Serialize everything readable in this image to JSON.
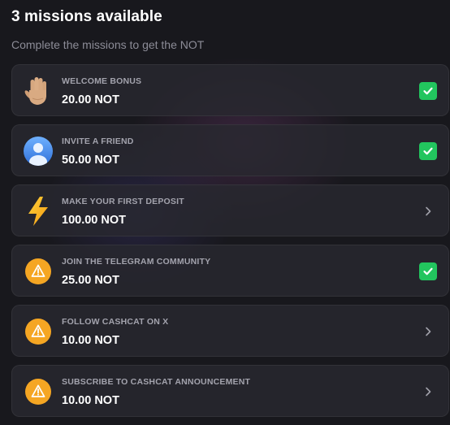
{
  "header": {
    "title": "3 missions available",
    "subtitle": "Complete the missions to get the NOT"
  },
  "missions": [
    {
      "name": "WELCOME BONUS",
      "reward": "20.00 NOT",
      "icon": "raised-hand-icon",
      "status": "completed"
    },
    {
      "name": "INVITE A FRIEND",
      "reward": "50.00 NOT",
      "icon": "user-avatar-icon",
      "status": "completed"
    },
    {
      "name": "MAKE YOUR FIRST DEPOSIT",
      "reward": "100.00 NOT",
      "icon": "lightning-bolt-icon",
      "status": "open"
    },
    {
      "name": "JOIN THE TELEGRAM COMMUNITY",
      "reward": "25.00 NOT",
      "icon": "warning-icon",
      "status": "completed"
    },
    {
      "name": "FOLLOW CASHCAT ON X",
      "reward": "10.00 NOT",
      "icon": "warning-icon",
      "status": "open"
    },
    {
      "name": "SUBSCRIBE TO CASHCAT ANNOUNCEMENT",
      "reward": "10.00 NOT",
      "icon": "warning-icon",
      "status": "open"
    }
  ],
  "colors": {
    "background": "#18181d",
    "card": "#28282f",
    "check": "#22c55e",
    "warning": "#f5a623",
    "muted_text": "#8c8c97"
  }
}
